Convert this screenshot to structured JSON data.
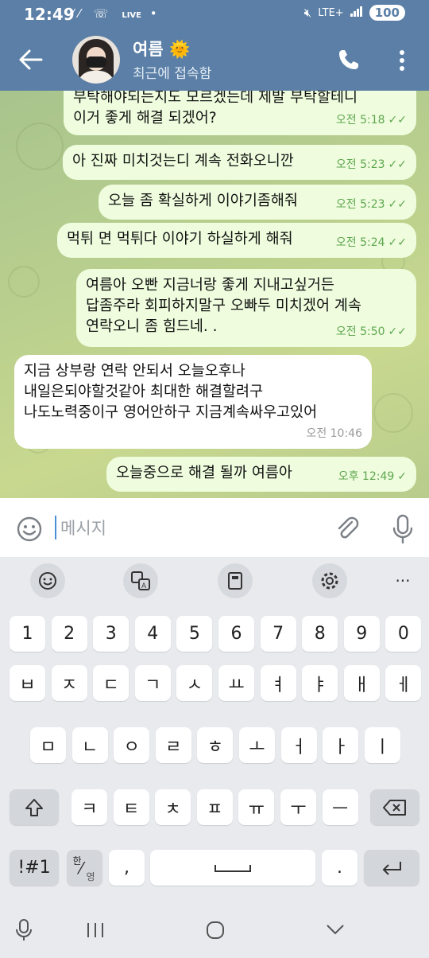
{
  "status_bar": {
    "time": "12:49",
    "left_icons": [
      "call-forward-icon",
      "missed-call-icon",
      "live-score-icon",
      "dot-icon"
    ],
    "live_label": "LIVE score",
    "network": "LTE+",
    "battery": "100"
  },
  "header": {
    "name": "여름 🌞",
    "status": "최근에 접속함"
  },
  "messages": [
    {
      "dir": "out",
      "lines": [
        "부탁해야되는지도 모르겠는데 제발 부탁할테니",
        "이거 좋게 해결 되겠어?"
      ],
      "time": "오전 5:18",
      "read": true
    },
    {
      "dir": "out",
      "lines": [
        "아 진짜 미치것는디 계속 전화오니깐"
      ],
      "time": "오전 5:23",
      "read": true
    },
    {
      "dir": "out",
      "lines": [
        "오늘 좀 확실하게 이야기좀해줘"
      ],
      "time": "오전 5:23",
      "read": true
    },
    {
      "dir": "out",
      "lines": [
        "먹튀 면 먹튀다 이야기 하실하게 해줘"
      ],
      "time": "오전 5:24",
      "read": true
    },
    {
      "dir": "out",
      "lines": [
        "여름아 오빤 지금너랑 좋게 지내고싶거든",
        "답좀주라 회피하지말구 오빠두 미치겠어 계속",
        "연락오니 좀 힘드네. ."
      ],
      "time": "오전 5:50",
      "read": true
    },
    {
      "dir": "in",
      "lines": [
        "지금 상부랑 연락 안되서 오늘오후나",
        "내일은되야할것같아 최대한 해결할려구",
        "나도노력중이구 영어안하구 지금계속싸우고있어"
      ],
      "time": "오전 10:46",
      "read": false
    },
    {
      "dir": "out",
      "lines": [
        "오늘중으로 해결 될까 여름아"
      ],
      "time": "오후 12:49",
      "read": false
    }
  ],
  "input": {
    "placeholder": "메시지"
  },
  "keyboard": {
    "toolbar": [
      "emoji-icon",
      "translate-icon",
      "clipboard-icon",
      "settings-icon",
      "more-icon"
    ],
    "row_numbers": [
      "1",
      "2",
      "3",
      "4",
      "5",
      "6",
      "7",
      "8",
      "9",
      "0"
    ],
    "row_1": [
      "ㅂ",
      "ㅈ",
      "ㄷ",
      "ㄱ",
      "ㅅ",
      "ㅛ",
      "ㅕ",
      "ㅑ",
      "ㅐ",
      "ㅔ"
    ],
    "row_2": [
      "ㅁ",
      "ㄴ",
      "ㅇ",
      "ㄹ",
      "ㅎ",
      "ㅗ",
      "ㅓ",
      "ㅏ",
      "ㅣ"
    ],
    "row_3": [
      "ㅋ",
      "ㅌ",
      "ㅊ",
      "ㅍ",
      "ㅠ",
      "ㅜ",
      "ㅡ"
    ],
    "symbols_key": "!#1",
    "lang_key_top": "한",
    "lang_key_bottom": "영",
    "comma_key": ",",
    "period_key": "."
  },
  "colors": {
    "header": "#5b7fa6",
    "outgoing_bubble": "#effdde",
    "incoming_bubble": "#ffffff",
    "read_check": "#5ea64f"
  }
}
